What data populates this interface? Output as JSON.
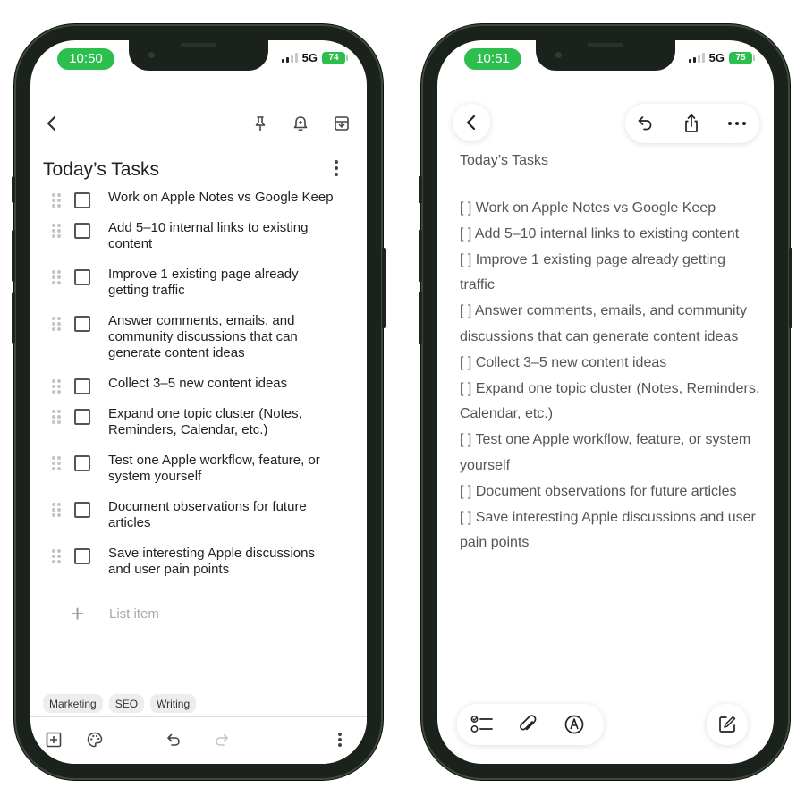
{
  "google_keep": {
    "status_bar": {
      "time": "10:50",
      "network": "5G",
      "battery": "74"
    },
    "toolbar_icons": [
      "back-arrow-icon",
      "pin-icon",
      "reminder-bell-icon",
      "archive-icon"
    ],
    "note_title": "Today’s Tasks",
    "items": [
      {
        "text": "Work on Apple Notes vs Google Keep",
        "checked": false
      },
      {
        "text": "Add 5–10 internal links to existing content",
        "checked": false
      },
      {
        "text": "Improve 1 existing page already getting traffic",
        "checked": false
      },
      {
        "text": "Answer comments, emails, and community discussions that can generate content ideas",
        "checked": false
      },
      {
        "text": "Collect 3–5 new content ideas",
        "checked": false
      },
      {
        "text": "Expand one topic cluster (Notes, Reminders, Calendar, etc.)",
        "checked": false
      },
      {
        "text": "Test one Apple workflow, feature, or system yourself",
        "checked": false
      },
      {
        "text": "Document observations for future articles",
        "checked": false
      },
      {
        "text": "Save interesting Apple discussions and user pain points",
        "checked": false
      }
    ],
    "add_item_label": "List item",
    "labels": [
      "Marketing",
      "SEO",
      "Writing"
    ],
    "bottom_icons": [
      "add-box-icon",
      "palette-icon",
      "undo-icon",
      "redo-icon",
      "more-vert-icon"
    ],
    "accent_color": "#2dbf4e"
  },
  "apple_notes": {
    "status_bar": {
      "time": "10:51",
      "network": "5G",
      "battery": "75"
    },
    "toolbar_icons": [
      "back-chevron-icon",
      "undo-icon",
      "share-icon",
      "more-icon"
    ],
    "note_title": "Today’s Tasks",
    "lines": [
      "[ ] Work on Apple Notes vs Google Keep",
      "[ ] Add 5–10 internal links to existing content",
      "[ ] Improve 1 existing page already getting traffic",
      "[ ] Answer comments, emails, and community discussions that can generate content ideas",
      "[ ] Collect 3–5 new content ideas",
      "[ ] Expand one topic cluster (Notes, Reminders, Calendar, etc.)",
      "[ ] Test one Apple workflow, feature, or system yourself",
      "[ ] Document observations for future articles",
      "[ ] Save interesting Apple discussions and user pain points"
    ],
    "bottom_icons": [
      "checklist-icon",
      "attachment-icon",
      "markup-icon",
      "compose-icon"
    ]
  }
}
